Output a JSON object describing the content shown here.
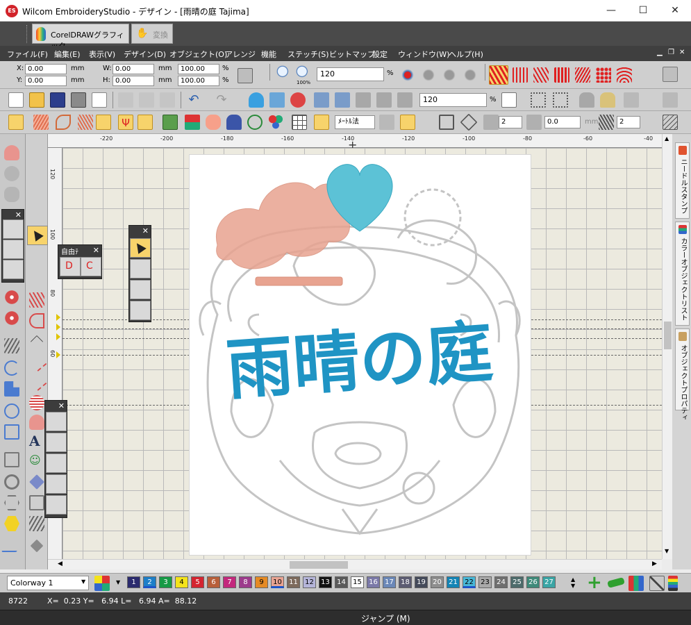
{
  "window": {
    "title": "Wilcom EmbroideryStudio - デザイン - [雨晴の庭          Tajima]",
    "app_icon": "ES",
    "minimize": "—",
    "maximize": "☐",
    "close": "✕"
  },
  "corel": {
    "button_label": "CorelDRAWグラフィック",
    "convert_label": "変換"
  },
  "menu": [
    {
      "label": "ファイル(F)"
    },
    {
      "label": "編集(E)"
    },
    {
      "label": "表示(V)"
    },
    {
      "label": "デザイン(D)"
    },
    {
      "label": "オブジェクト(O)"
    },
    {
      "label": "アレンジ"
    },
    {
      "label": "機能"
    },
    {
      "label": "ステッチ(S)"
    },
    {
      "label": "ビットマップ"
    },
    {
      "label": "設定"
    },
    {
      "label": "ウィンドウ(W)"
    },
    {
      "label": "ヘルプ(H)"
    }
  ],
  "position": {
    "x_label": "X:",
    "x_value": "0.00",
    "x_unit": "mm",
    "y_label": "Y:",
    "y_value": "0.00",
    "y_unit": "mm",
    "w_label": "W:",
    "w_value": "0.00",
    "w_unit": "mm",
    "w_pct": "100.00",
    "w_pct_unit": "%",
    "h_label": "H:",
    "h_value": "0.00",
    "h_unit": "mm",
    "h_pct": "100.00",
    "h_pct_unit": "%"
  },
  "zoom": {
    "value": "120",
    "unit": "%",
    "icon_label": "100%"
  },
  "zoom2": {
    "value": "120",
    "unit": "%"
  },
  "units": {
    "value": "ﾒｰﾄﾙ法"
  },
  "spacing": {
    "value1": "2",
    "value2": "0.0",
    "unit": "mm",
    "value3": "2"
  },
  "rulers": {
    "top": [
      "-220",
      "-200",
      "-180",
      "-160",
      "-140",
      "-120",
      "-100",
      "-80",
      "-60",
      "-40"
    ],
    "left": [
      "120",
      "100",
      "80",
      "60"
    ]
  },
  "design_text": "雨晴の庭",
  "panels": {
    "free_title": "自由ﾃ"
  },
  "right_tabs": [
    {
      "label": "ニードルスタンプ"
    },
    {
      "label": "カラーオブジェクトリスト"
    },
    {
      "label": "オブジェクトプロパティ"
    }
  ],
  "colorway": {
    "value": "Colorway 1"
  },
  "palette": [
    {
      "n": "1",
      "color": "#2b2b6e",
      "fg": "#fff"
    },
    {
      "n": "2",
      "color": "#1e7fc8",
      "fg": "#fff",
      "selected": true
    },
    {
      "n": "3",
      "color": "#169a45",
      "fg": "#fff"
    },
    {
      "n": "4",
      "color": "#f4e31a",
      "fg": "#000"
    },
    {
      "n": "5",
      "color": "#d42430",
      "fg": "#fff"
    },
    {
      "n": "6",
      "color": "#b85f3a",
      "fg": "#fff"
    },
    {
      "n": "7",
      "color": "#c3287d",
      "fg": "#fff"
    },
    {
      "n": "8",
      "color": "#9c3a8c",
      "fg": "#fff"
    },
    {
      "n": "9",
      "color": "#e58a24",
      "fg": "#000"
    },
    {
      "n": "10",
      "color": "#e9a493",
      "fg": "#000",
      "selected": true
    },
    {
      "n": "11",
      "color": "#7d6a5c",
      "fg": "#fff"
    },
    {
      "n": "12",
      "color": "#b5b5d9",
      "fg": "#000"
    },
    {
      "n": "13",
      "color": "#121212",
      "fg": "#fff"
    },
    {
      "n": "14",
      "color": "#5a5a5a",
      "fg": "#fff"
    },
    {
      "n": "15",
      "color": "#ffffff",
      "fg": "#000"
    },
    {
      "n": "16",
      "color": "#7b79a8",
      "fg": "#fff"
    },
    {
      "n": "17",
      "color": "#6b88b8",
      "fg": "#fff"
    },
    {
      "n": "18",
      "color": "#5c5c72",
      "fg": "#fff"
    },
    {
      "n": "19",
      "color": "#444a5a",
      "fg": "#fff"
    },
    {
      "n": "20",
      "color": "#8e8e8e",
      "fg": "#fff"
    },
    {
      "n": "21",
      "color": "#1384b5",
      "fg": "#fff"
    },
    {
      "n": "22",
      "color": "#48b8d8",
      "fg": "#000",
      "selected": true
    },
    {
      "n": "23",
      "color": "#a9a9a9",
      "fg": "#000"
    },
    {
      "n": "24",
      "color": "#6f6f6f",
      "fg": "#fff"
    },
    {
      "n": "25",
      "color": "#4d6b6b",
      "fg": "#fff"
    },
    {
      "n": "26",
      "color": "#3f8a7a",
      "fg": "#fff"
    },
    {
      "n": "27",
      "color": "#3aa5a5",
      "fg": "#fff"
    }
  ],
  "status": {
    "stitch_count": "8722",
    "coords": "X=  0.23 Y=   6.94 L=   6.94 A=  88.12"
  },
  "command": {
    "label": "ジャンプ (M)"
  },
  "colors": {
    "menubar": "#3f3f3f",
    "highlight": "#f7d36b",
    "thread_blue": "#1f94c4",
    "thread_cyan": "#5cc2d6",
    "thread_pink": "#e8a390",
    "thread_grey": "#c4c4c4"
  }
}
